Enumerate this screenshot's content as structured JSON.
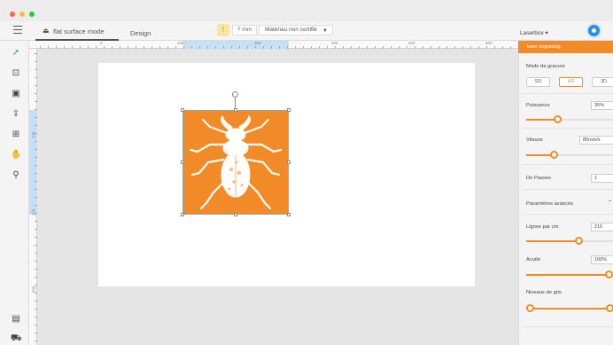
{
  "titlebar": {
    "controls": [
      {
        "name": "close",
        "color": "#ff5f57"
      },
      {
        "name": "minimize",
        "color": "#febc2e"
      },
      {
        "name": "zoom",
        "color": "#28c840"
      }
    ]
  },
  "toolbar": {
    "mode_label": "flat surface mode",
    "design_label": "Design",
    "focus_value": "? mm",
    "material_value": "Matériau non certifié",
    "device_label": "Laserbox",
    "accent_color": "#f28a27"
  },
  "rulers": {
    "h_labels": [
      "0",
      "100",
      "200",
      "300",
      "400",
      "500"
    ],
    "v_labels": [
      "100",
      "200",
      "300"
    ]
  },
  "panel": {
    "header": "laser engraving",
    "engrave_mode_label": "Mode de gravure",
    "engrave_modes": [
      "SD",
      "HD",
      "3D"
    ],
    "power_label": "Puissance",
    "power_value": "35%",
    "power_level": 0.35,
    "speed_label": "Vitesse",
    "speed_value": "85mm/s",
    "speed_level": 0.3,
    "passes_label": "De Passes",
    "passes_value": "1",
    "advanced_label": "Paramètres avancés",
    "lpc_label": "Lignes par cm",
    "lpc_value": "215",
    "lpc_level": 0.62,
    "sharpness_label": "Acuité",
    "sharpness_value": "100%",
    "sharpness_level": 1.0,
    "gray_label": "Niveaux de gris"
  }
}
